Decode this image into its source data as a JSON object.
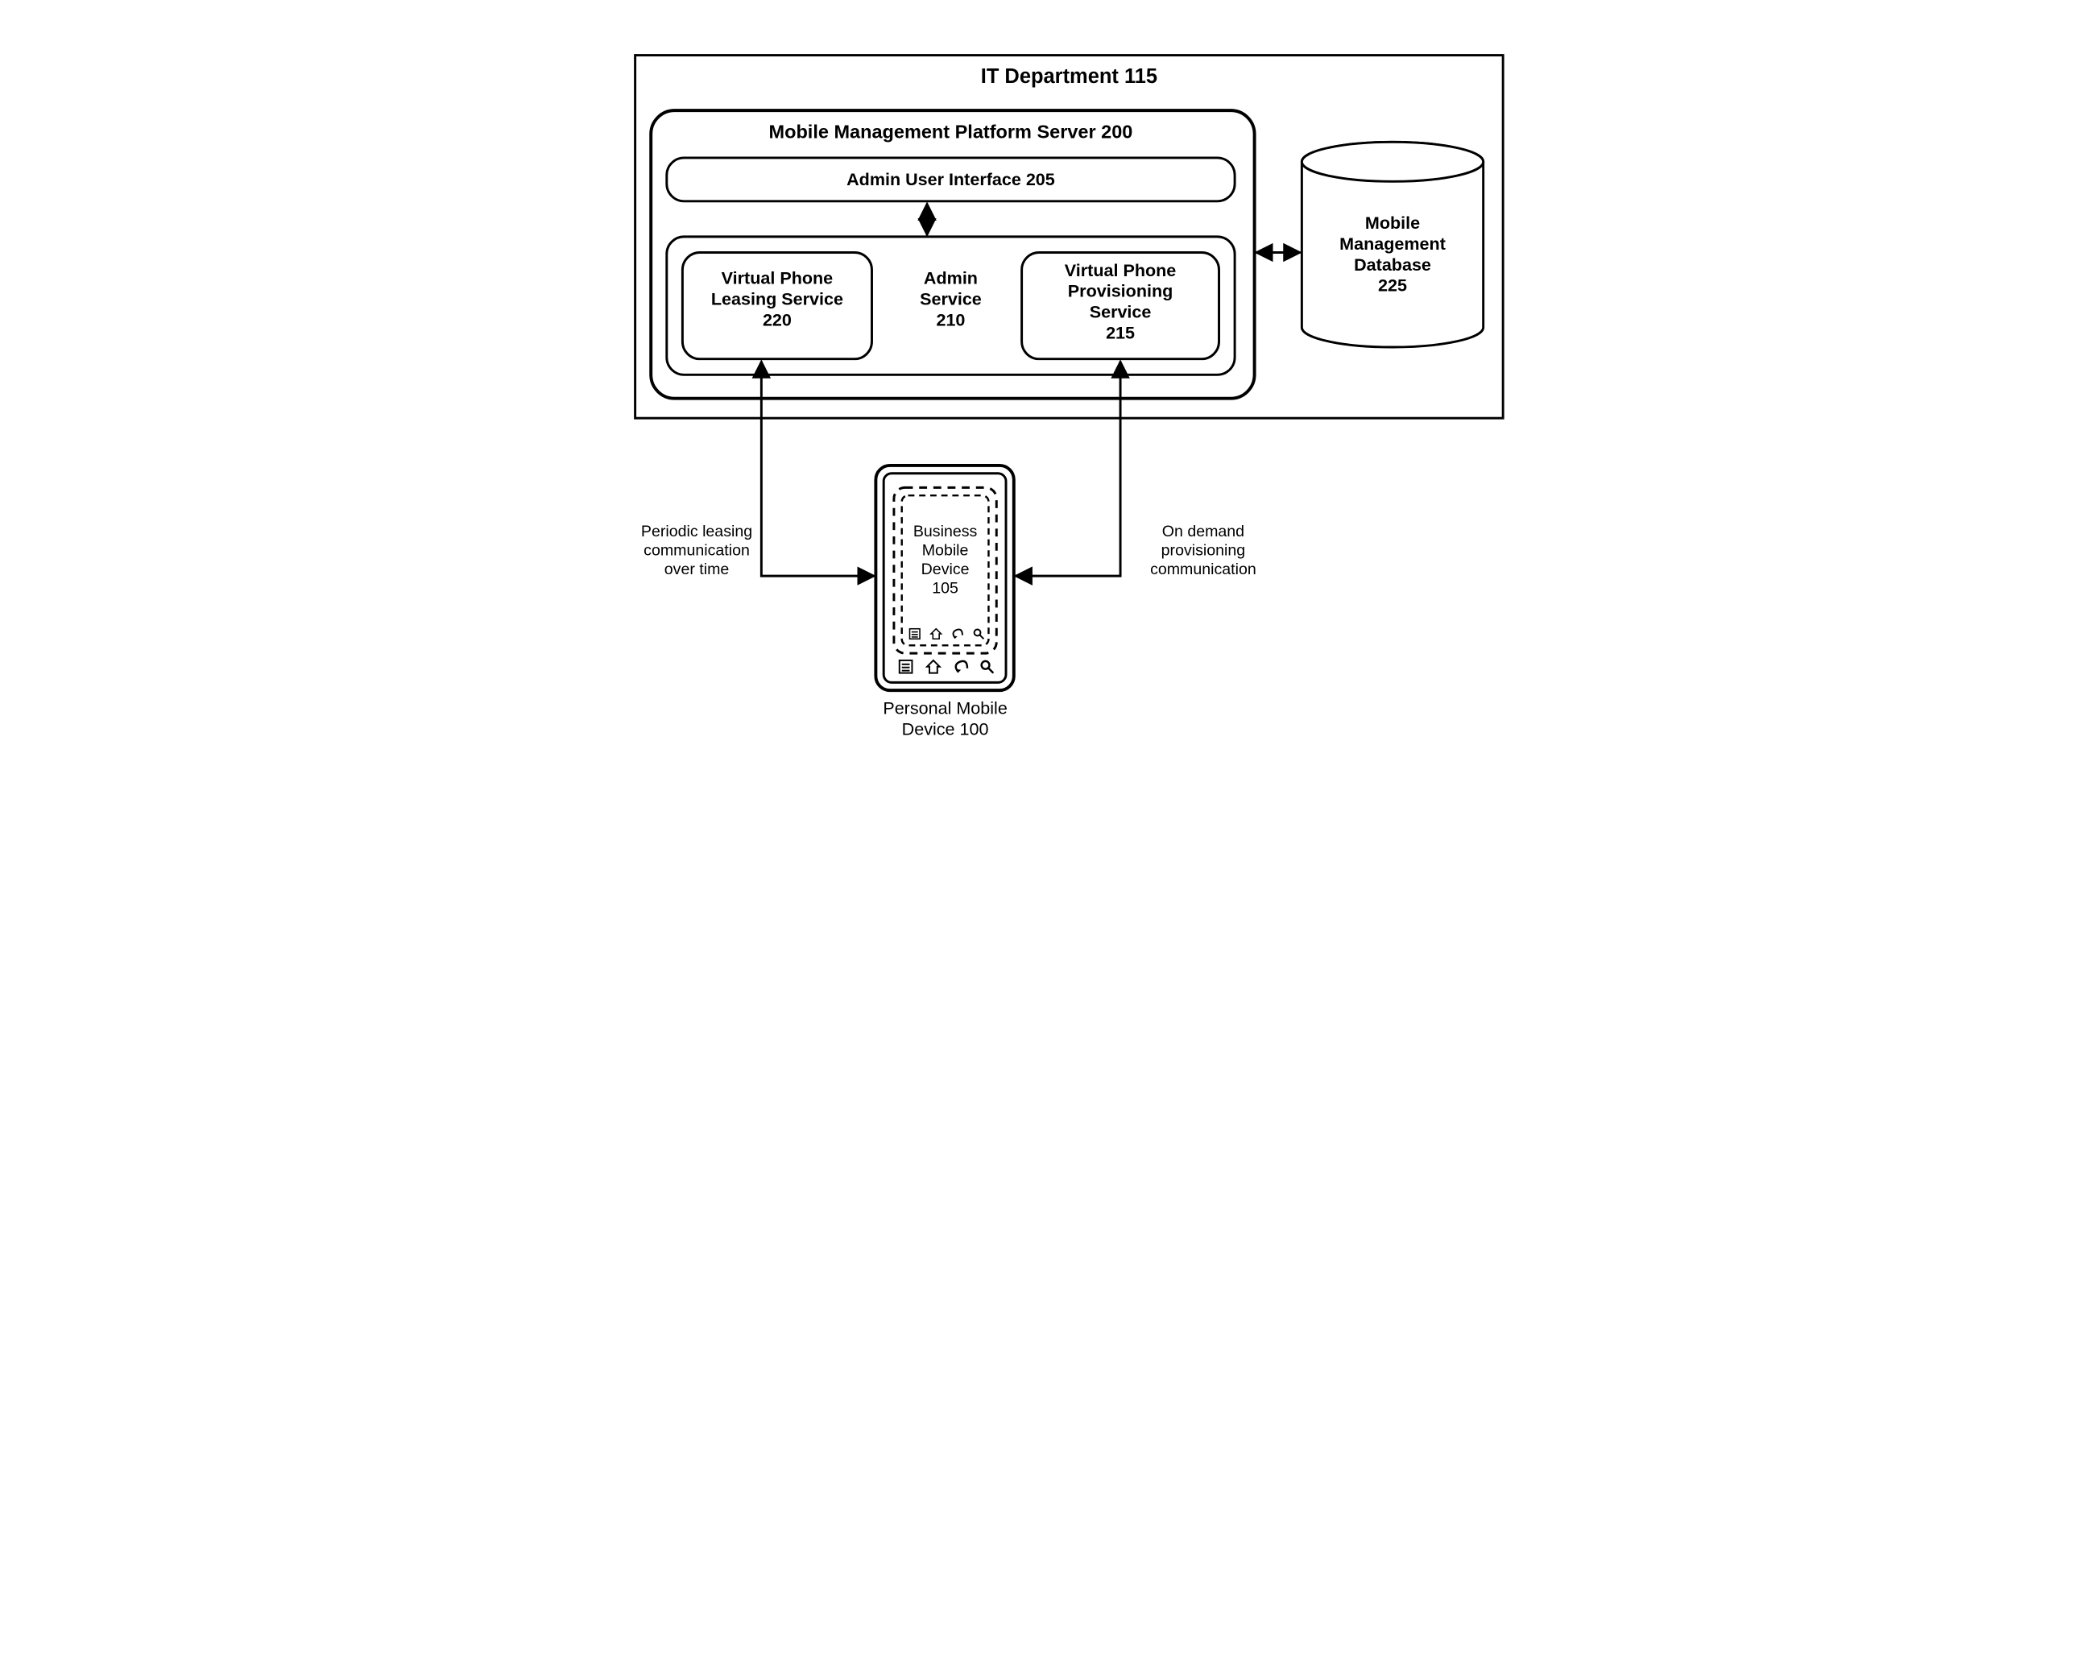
{
  "title": "IT Department 115",
  "server": {
    "title": "Mobile Management Platform Server 200",
    "ui": "Admin User Interface 205",
    "leasing": "Virtual Phone\nLeasing Service\n220",
    "admin": "Admin\nService\n210",
    "provisioning": "Virtual Phone\nProvisioning\nService\n215"
  },
  "database": "Mobile\nManagement\nDatabase\n225",
  "leftlabel": "Periodic leasing\ncommunication\nover time",
  "rightlabel": "On demand\nprovisioning\ncommunication",
  "business_device": "Business\nMobile\nDevice\n105",
  "personal_device": "Personal Mobile\nDevice 100"
}
